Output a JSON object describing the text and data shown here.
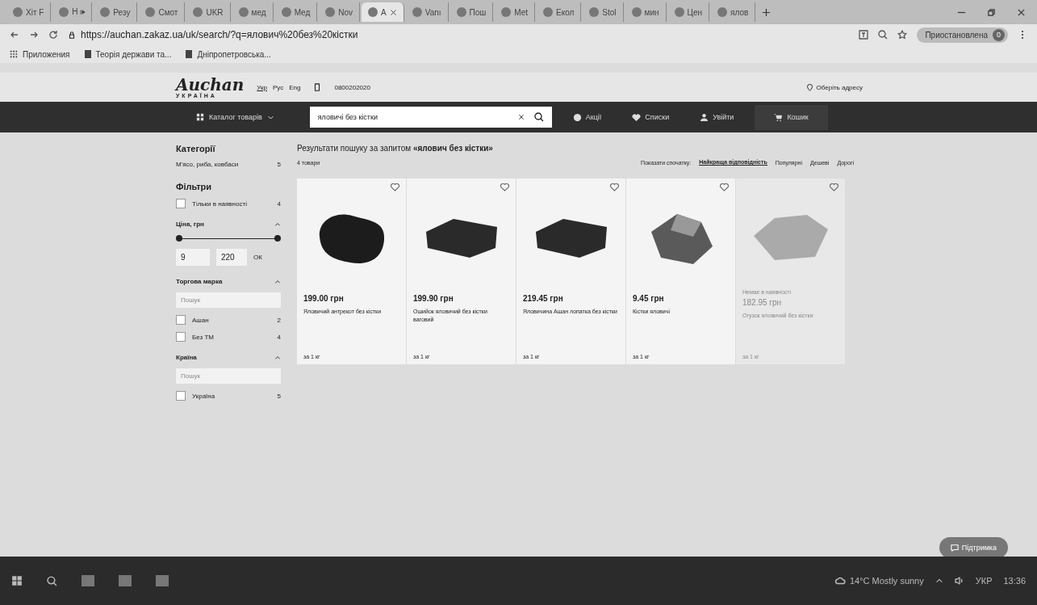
{
  "browser": {
    "tabs": [
      {
        "label": "Хіт F",
        "selected": false
      },
      {
        "label": "Н 🕪",
        "selected": false
      },
      {
        "label": "Резу",
        "selected": false
      },
      {
        "label": "Смот",
        "selected": false
      },
      {
        "label": "UKR",
        "selected": false
      },
      {
        "label": "мед",
        "selected": false
      },
      {
        "label": "Мед",
        "selected": false
      },
      {
        "label": "Nov",
        "selected": false
      },
      {
        "label": "А",
        "selected": true
      },
      {
        "label": "Vanı",
        "selected": false
      },
      {
        "label": "Пош",
        "selected": false
      },
      {
        "label": "Met",
        "selected": false
      },
      {
        "label": "Екол",
        "selected": false
      },
      {
        "label": "Stol",
        "selected": false
      },
      {
        "label": "мин",
        "selected": false
      },
      {
        "label": "Цен",
        "selected": false
      },
      {
        "label": "ялов",
        "selected": false
      }
    ],
    "url": "https://auchan.zakaz.ua/uk/search/?q=ялович%20без%20кістки",
    "profile_label": "Приостановлена",
    "profile_badge": "0",
    "bookmarks": [
      "Приложения",
      "Теорія держави та...",
      "Дніпропетровська..."
    ]
  },
  "site": {
    "logo": "Auchan",
    "logo_sub": "УКРАЇНА",
    "languages": [
      {
        "label": "Укр",
        "selected": true
      },
      {
        "label": "Рус",
        "selected": false
      },
      {
        "label": "Eng",
        "selected": false
      }
    ],
    "phone": "0800202020",
    "address_link": "Оберіть адресу",
    "catalog_button": "Каталог товарів",
    "search_value": "яловичі без кістки",
    "nav": [
      {
        "label": "Акції",
        "kind": "promo"
      },
      {
        "label": "Списки",
        "kind": "lists"
      },
      {
        "label": "Увійти",
        "kind": "login"
      },
      {
        "label": "Кошик",
        "kind": "cart"
      }
    ]
  },
  "sidebar": {
    "categories_title": "Категорії",
    "categories": [
      {
        "label": "М'ясо, риба, ковбаси",
        "count": "5"
      }
    ],
    "filters_title": "Фільтри",
    "in_stock": {
      "label": "Тільки в наявності",
      "count": "4",
      "checked": false
    },
    "price": {
      "title": "Ціна, грн",
      "level": 1,
      "min": "9",
      "max": "220",
      "ok": "ОК"
    },
    "brand": {
      "title": "Торгова марка",
      "placeholder": "Пошук",
      "items": [
        {
          "label": "Ашан",
          "count": "2",
          "checked": false
        },
        {
          "label": "Без ТМ",
          "count": "4",
          "checked": false
        }
      ]
    },
    "country": {
      "title": "Країна",
      "placeholder": "Пошук",
      "items": [
        {
          "label": "Україна",
          "count": "5",
          "checked": false
        }
      ]
    }
  },
  "results": {
    "heading": "Результати пошуку за запитом **«ялович без кістки»**",
    "count": "4 товари",
    "sort_label": "Показати спочатку:",
    "sort_options": [
      {
        "label": "Найкраща відповідність",
        "selected": true
      },
      {
        "label": "Популярні",
        "selected": false
      },
      {
        "label": "Дешеві",
        "selected": false
      },
      {
        "label": "Дорогі",
        "selected": false
      }
    ],
    "products": [
      {
        "price": "199.00 грн",
        "name": "Яловичий антрекот без кістки",
        "unit": "за 1 кг",
        "available": true,
        "kind": "dark"
      },
      {
        "price": "199.90 грн",
        "name": "Ошийок яловичий без кістки ваговий",
        "unit": "за 1 кг",
        "available": true,
        "kind": "slab"
      },
      {
        "price": "219.45 грн",
        "name": "Яловичина Ашан лопатка без кістки",
        "unit": "за 1 кг",
        "available": true,
        "kind": "slab"
      },
      {
        "price": "9.45 грн",
        "name": "Кістки яловичі",
        "unit": "за 1 кг",
        "available": true,
        "kind": "bones"
      },
      {
        "status": "Немає в наявності",
        "price": "182.95 грн",
        "name": "Огузок яловичий без кістки",
        "unit": "за 1 кг",
        "available": false,
        "kind": "light"
      }
    ]
  },
  "support_button": "Підтримка",
  "taskbar": {
    "weather": "14°C  Mostly sunny",
    "language": "УКР",
    "time": "13:36"
  }
}
